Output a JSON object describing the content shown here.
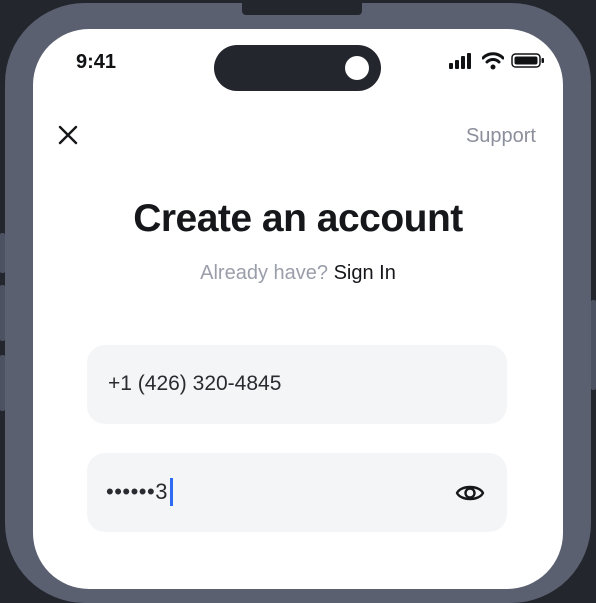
{
  "status_bar": {
    "time": "9:41",
    "icons": [
      "signal-icon",
      "wifi-icon",
      "battery-icon"
    ]
  },
  "header": {
    "close_icon": "close-icon",
    "support_label": "Support"
  },
  "title": "Create an account",
  "signin": {
    "prompt": "Already have?",
    "link_label": "Sign In"
  },
  "form": {
    "phone_value": "+1 (426) 320-4845",
    "password_value": "••••••3",
    "password_toggle_icon": "eye-icon"
  },
  "colors": {
    "background": "#24262d",
    "frame": "#5b6071",
    "caret": "#2f6bf0",
    "field_background": "#f4f5f7"
  }
}
